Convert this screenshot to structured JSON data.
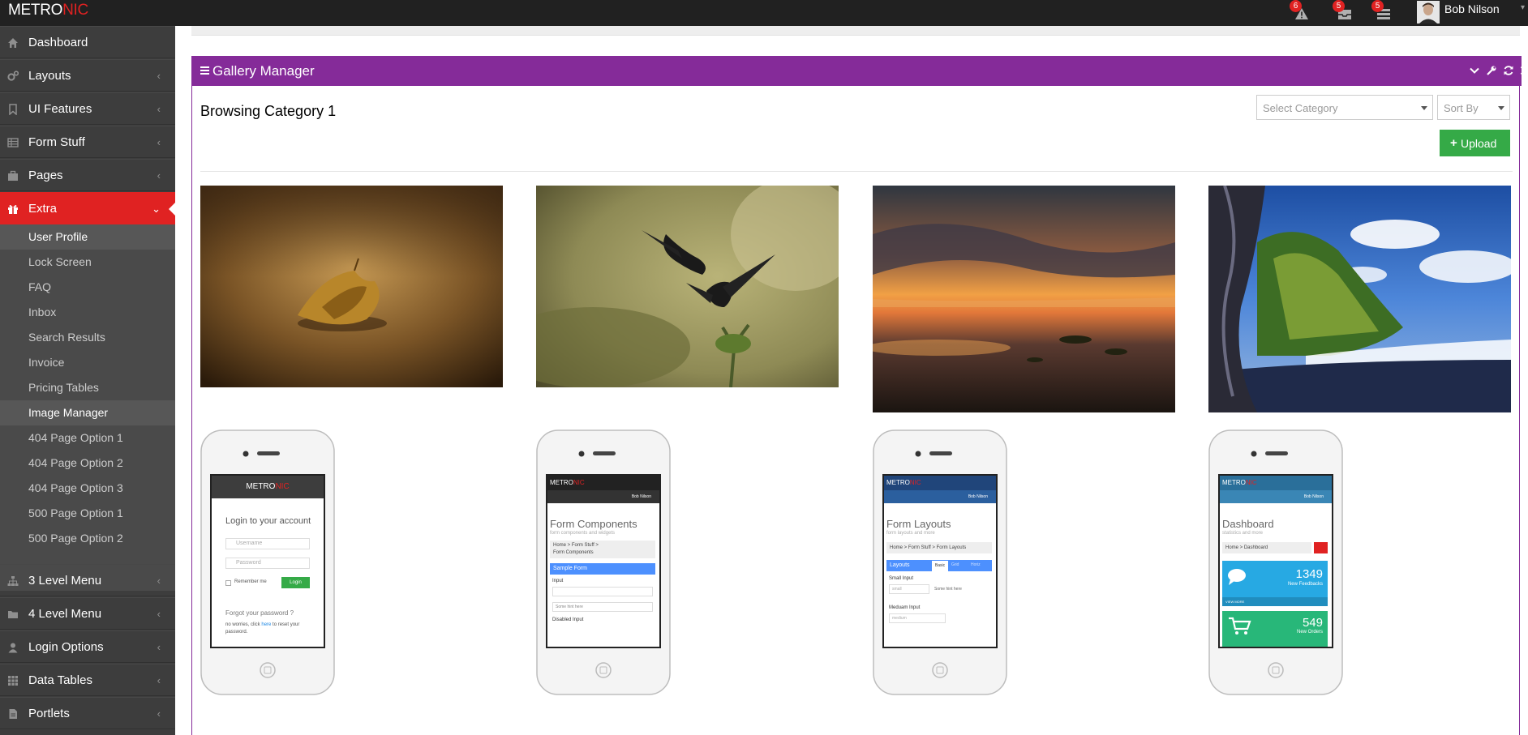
{
  "header": {
    "logo": {
      "part1": "METRO",
      "part2": "NIC"
    },
    "notifications": [
      {
        "icon": "warning-icon",
        "count": "6"
      },
      {
        "icon": "inbox-icon",
        "count": "5"
      },
      {
        "icon": "tasks-icon",
        "count": "5"
      }
    ],
    "user": {
      "name": "Bob Nilson"
    }
  },
  "sidebar": {
    "items": [
      {
        "label": "Dashboard",
        "icon": "home-icon"
      },
      {
        "label": "Layouts",
        "icon": "cogs-icon"
      },
      {
        "label": "UI Features",
        "icon": "bookmark-icon"
      },
      {
        "label": "Form Stuff",
        "icon": "table-icon"
      },
      {
        "label": "Pages",
        "icon": "briefcase-icon"
      },
      {
        "label": "Extra",
        "icon": "gift-icon"
      },
      {
        "label": "3 Level Menu",
        "icon": "sitemap-icon"
      },
      {
        "label": "4 Level Menu",
        "icon": "folder-icon"
      },
      {
        "label": "Login Options",
        "icon": "user-icon"
      },
      {
        "label": "Data Tables",
        "icon": "grid-icon"
      },
      {
        "label": "Portlets",
        "icon": "file-icon"
      }
    ],
    "extra_submenu": [
      "User Profile",
      "Lock Screen",
      "FAQ",
      "Inbox",
      "Search Results",
      "Invoice",
      "Pricing Tables",
      "Image Manager",
      "404 Page Option 1",
      "404 Page Option 2",
      "404 Page Option 3",
      "500 Page Option 1",
      "500 Page Option 2"
    ]
  },
  "portlet": {
    "title": "Gallery Manager",
    "browsing": "Browsing Category 1",
    "select_category": "Select Category",
    "sort_by": "Sort By",
    "upload_label": "Upload"
  },
  "gallery": {
    "photos": [
      "leaf-photo",
      "birds-photo",
      "sunset-beach-photo",
      "coast-cliff-photo"
    ],
    "phones": [
      {
        "logo1": "METRO",
        "logo2": "NIC",
        "heading": "Login to your account",
        "username": "Username",
        "password": "Password",
        "remember": "Remember me",
        "login_btn": "Login",
        "forgot": "Forgot your password ?",
        "reset1": "no worries, click",
        "reset_link": "here",
        "reset2": "to reset your",
        "reset3": "password."
      },
      {
        "logo1": "METRO",
        "logo2": "NIC",
        "user": "Bob Nilson",
        "title": "Form Components",
        "subtitle": "form components and widgets",
        "crumb": "Home  >  Form Stuff  >",
        "crumb2": "Form Components",
        "portlet": "Sample Form",
        "label1": "Input",
        "hint": "Some hint here",
        "label2": "Disabled Input"
      },
      {
        "logo1": "METRO",
        "logo2": "NIC",
        "user": "Bob Nilson",
        "title": "Form Layouts",
        "subtitle": "form layouts and more",
        "crumb": "Home  >  Form Stuff  >  Form Layouts",
        "portlet": "Layouts",
        "tab1": "Basic",
        "tab2": "Grid",
        "tab3": "Horiz",
        "small_input": "Small Input",
        "small_placeholder": "small",
        "hint": "Some hint here",
        "medium_input": "Meduam Input",
        "medium_placeholder": "medium"
      },
      {
        "logo1": "METRO",
        "logo2": "NIC",
        "user": "Bob Nilson",
        "title": "Dashboard",
        "subtitle": "statistics and more",
        "crumb": "Home  >  Dashboard",
        "stat1_number": "1349",
        "stat1_label": "New Feedbacks",
        "stat1_more": "VIEW MORE",
        "stat2_number": "549",
        "stat2_label": "New Orders"
      }
    ]
  },
  "colors": {
    "header_bg": "#212121",
    "sidebar_bg": "#3d3d3d",
    "active_red": "#e02222",
    "portlet_purple": "#852b99",
    "upload_green": "#35aa47"
  }
}
